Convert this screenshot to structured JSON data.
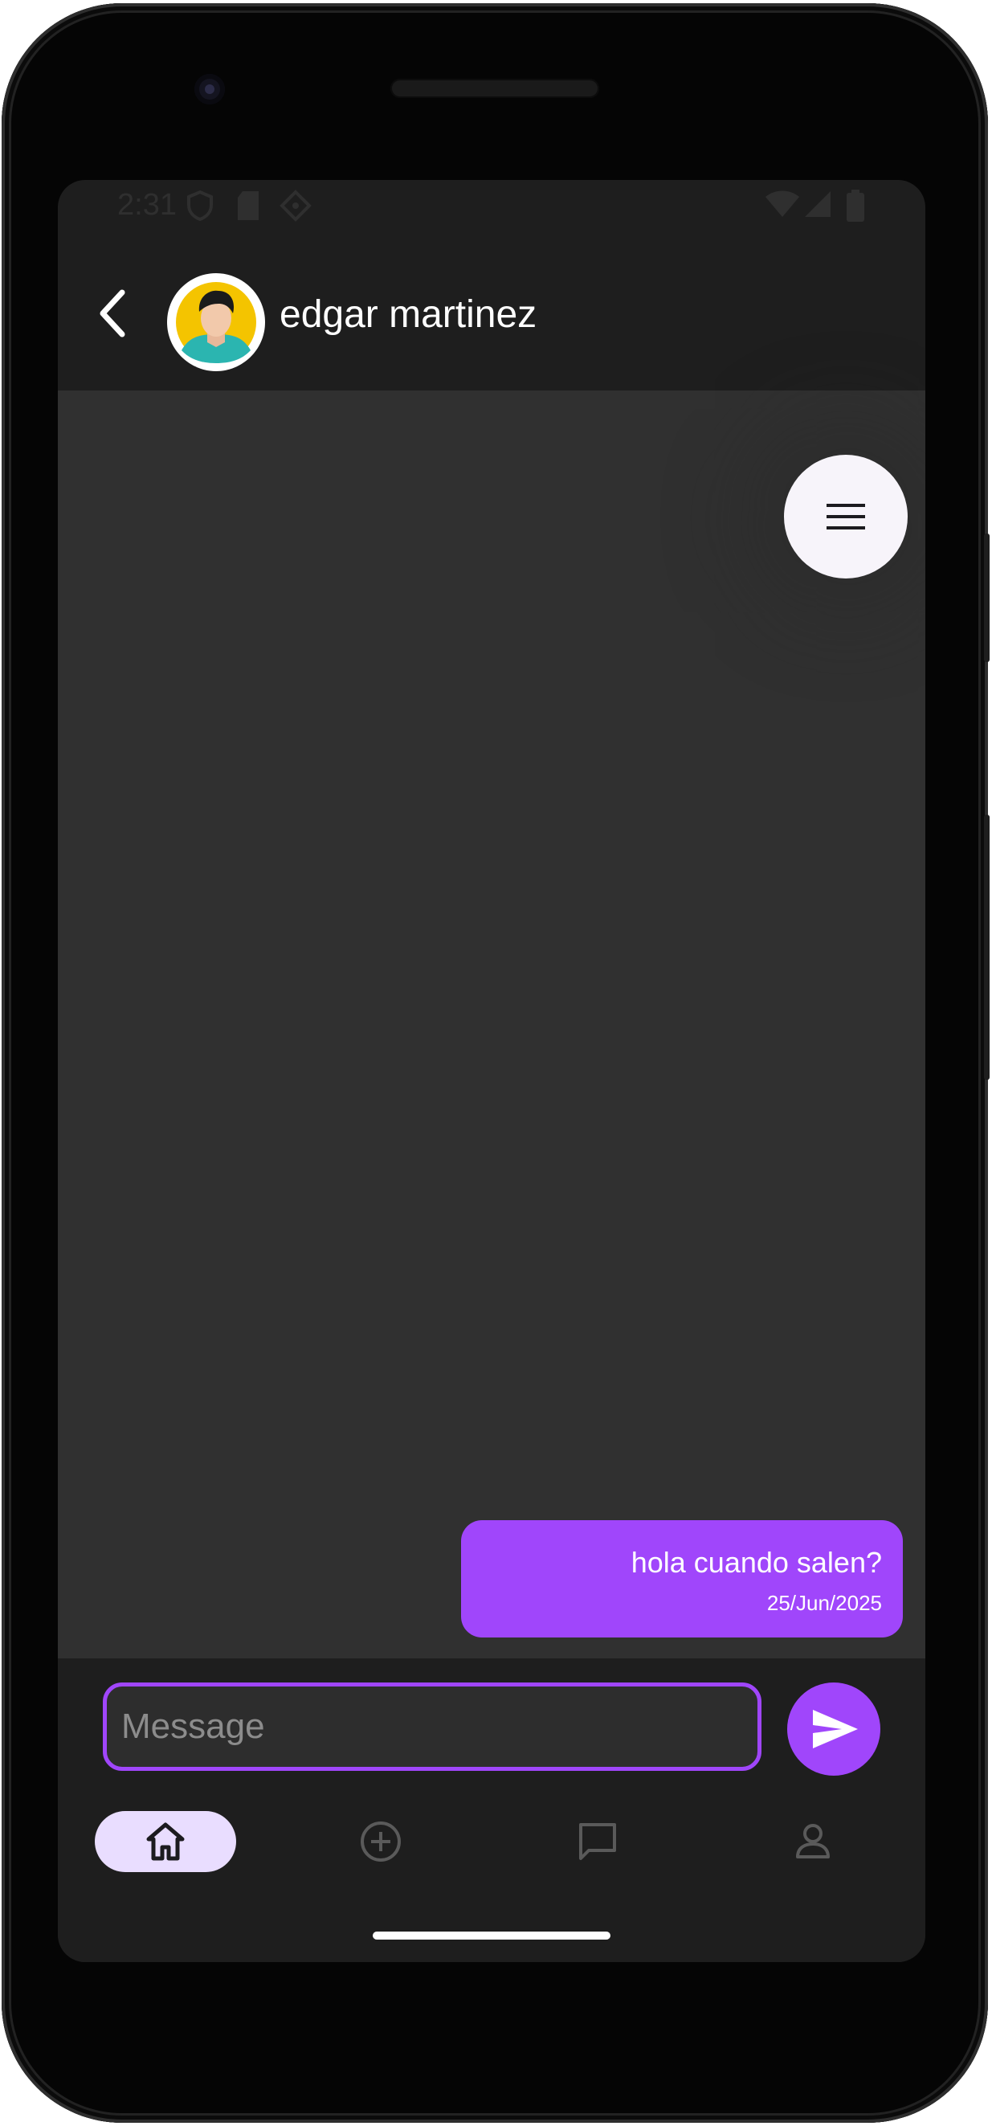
{
  "status_bar": {
    "time": "2:31"
  },
  "header": {
    "back_icon": "chevron-left-icon",
    "contact_name": "edgar martinez",
    "avatar_icon": "person-avatar-icon"
  },
  "chat": {
    "menu_icon": "hamburger-menu-icon",
    "messages": [
      {
        "text": "hola cuando salen?",
        "date": "25/Jun/2025",
        "outgoing": true
      }
    ]
  },
  "composer": {
    "placeholder": "Message",
    "value": "",
    "send_icon": "send-icon"
  },
  "bottom_nav": {
    "items": [
      {
        "icon": "home-icon",
        "active": true
      },
      {
        "icon": "add-circle-icon",
        "active": false
      },
      {
        "icon": "chat-bubble-icon",
        "active": false
      },
      {
        "icon": "person-icon",
        "active": false
      }
    ]
  },
  "colors": {
    "accent": "#a046fb",
    "active_nav_pill": "#e9ddff",
    "app_bar": "#1e1e1e",
    "chat_background": "#303030"
  }
}
